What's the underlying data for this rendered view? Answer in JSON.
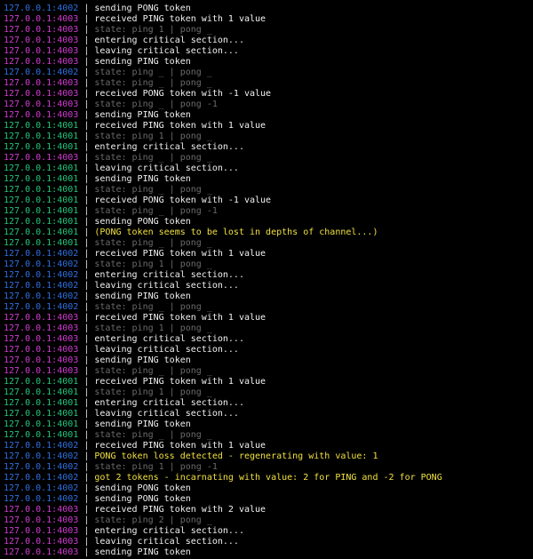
{
  "colors": {
    "host4001": "#22c57a",
    "host4002": "#2f6fe0",
    "host4003": "#d13ad1",
    "text": "#f2f2f2",
    "state": "#6b6b6b",
    "warn": "#f0e040"
  },
  "separator": "|",
  "lines": [
    {
      "host": "127.0.0.1:4002",
      "kind": "text",
      "msg": "sending PONG token"
    },
    {
      "host": "127.0.0.1:4003",
      "kind": "text",
      "msg": "received PING token with 1 value"
    },
    {
      "host": "127.0.0.1:4003",
      "kind": "state",
      "msg": "state: ping 1 | pong _"
    },
    {
      "host": "127.0.0.1:4003",
      "kind": "text",
      "msg": "entering critical section..."
    },
    {
      "host": "127.0.0.1:4003",
      "kind": "text",
      "msg": "leaving critical section..."
    },
    {
      "host": "127.0.0.1:4003",
      "kind": "text",
      "msg": "sending PING token"
    },
    {
      "host": "127.0.0.1:4002",
      "kind": "state",
      "msg": "state: ping _ | pong _"
    },
    {
      "host": "127.0.0.1:4003",
      "kind": "state",
      "msg": "state: ping _ | pong _"
    },
    {
      "host": "127.0.0.1:4003",
      "kind": "text",
      "msg": "received PONG token with -1 value"
    },
    {
      "host": "127.0.0.1:4003",
      "kind": "state",
      "msg": "state: ping _ | pong -1"
    },
    {
      "host": "127.0.0.1:4003",
      "kind": "text",
      "msg": "sending PING token"
    },
    {
      "host": "127.0.0.1:4001",
      "kind": "text",
      "msg": "received PING token with 1 value"
    },
    {
      "host": "127.0.0.1:4001",
      "kind": "state",
      "msg": "state: ping 1 | pong _"
    },
    {
      "host": "127.0.0.1:4001",
      "kind": "text",
      "msg": "entering critical section..."
    },
    {
      "host": "127.0.0.1:4003",
      "kind": "state",
      "msg": "state: ping _ | pong _"
    },
    {
      "host": "127.0.0.1:4001",
      "kind": "text",
      "msg": "leaving critical section..."
    },
    {
      "host": "127.0.0.1:4001",
      "kind": "text",
      "msg": "sending PING token"
    },
    {
      "host": "127.0.0.1:4001",
      "kind": "state",
      "msg": "state: ping _ | pong _"
    },
    {
      "host": "127.0.0.1:4001",
      "kind": "text",
      "msg": "received PONG token with -1 value"
    },
    {
      "host": "127.0.0.1:4001",
      "kind": "state",
      "msg": "state: ping _ | pong -1"
    },
    {
      "host": "127.0.0.1:4001",
      "kind": "text",
      "msg": "sending PONG token"
    },
    {
      "host": "127.0.0.1:4001",
      "kind": "warn",
      "msg": "(PONG token seems to be lost in depths of channel...)"
    },
    {
      "host": "127.0.0.1:4001",
      "kind": "state",
      "msg": "state: ping _ | pong _"
    },
    {
      "host": "127.0.0.1:4002",
      "kind": "text",
      "msg": "received PING token with 1 value"
    },
    {
      "host": "127.0.0.1:4002",
      "kind": "state",
      "msg": "state: ping 1 | pong _"
    },
    {
      "host": "127.0.0.1:4002",
      "kind": "text",
      "msg": "entering critical section..."
    },
    {
      "host": "127.0.0.1:4002",
      "kind": "text",
      "msg": "leaving critical section..."
    },
    {
      "host": "127.0.0.1:4002",
      "kind": "text",
      "msg": "sending PING token"
    },
    {
      "host": "127.0.0.1:4002",
      "kind": "state",
      "msg": "state: ping _ | pong _"
    },
    {
      "host": "127.0.0.1:4003",
      "kind": "text",
      "msg": "received PING token with 1 value"
    },
    {
      "host": "127.0.0.1:4003",
      "kind": "state",
      "msg": "state: ping 1 | pong _"
    },
    {
      "host": "127.0.0.1:4003",
      "kind": "text",
      "msg": "entering critical section..."
    },
    {
      "host": "127.0.0.1:4003",
      "kind": "text",
      "msg": "leaving critical section..."
    },
    {
      "host": "127.0.0.1:4003",
      "kind": "text",
      "msg": "sending PING token"
    },
    {
      "host": "127.0.0.1:4003",
      "kind": "state",
      "msg": "state: ping _ | pong _"
    },
    {
      "host": "127.0.0.1:4001",
      "kind": "text",
      "msg": "received PING token with 1 value"
    },
    {
      "host": "127.0.0.1:4001",
      "kind": "state",
      "msg": "state: ping 1 | pong _"
    },
    {
      "host": "127.0.0.1:4001",
      "kind": "text",
      "msg": "entering critical section..."
    },
    {
      "host": "127.0.0.1:4001",
      "kind": "text",
      "msg": "leaving critical section..."
    },
    {
      "host": "127.0.0.1:4001",
      "kind": "text",
      "msg": "sending PING token"
    },
    {
      "host": "127.0.0.1:4001",
      "kind": "state",
      "msg": "state: ping _ | pong _"
    },
    {
      "host": "127.0.0.1:4002",
      "kind": "text",
      "msg": "received PING token with 1 value"
    },
    {
      "host": "127.0.0.1:4002",
      "kind": "warn",
      "msg": "PONG token loss detected - regenerating with value: 1"
    },
    {
      "host": "127.0.0.1:4002",
      "kind": "state",
      "msg": "state: ping 1 | pong -1"
    },
    {
      "host": "127.0.0.1:4002",
      "kind": "warn",
      "msg": "got 2 tokens - incarnating with value: 2 for PING and -2 for PONG"
    },
    {
      "host": "127.0.0.1:4002",
      "kind": "text",
      "msg": "sending PONG token"
    },
    {
      "host": "127.0.0.1:4002",
      "kind": "text",
      "msg": "sending PONG token"
    },
    {
      "host": "127.0.0.1:4003",
      "kind": "text",
      "msg": "received PING token with 2 value"
    },
    {
      "host": "127.0.0.1:4003",
      "kind": "state",
      "msg": "state: ping 2 | pong _"
    },
    {
      "host": "127.0.0.1:4003",
      "kind": "text",
      "msg": "entering critical section..."
    },
    {
      "host": "127.0.0.1:4003",
      "kind": "text",
      "msg": "leaving critical section..."
    },
    {
      "host": "127.0.0.1:4003",
      "kind": "text",
      "msg": "sending PING token"
    }
  ]
}
